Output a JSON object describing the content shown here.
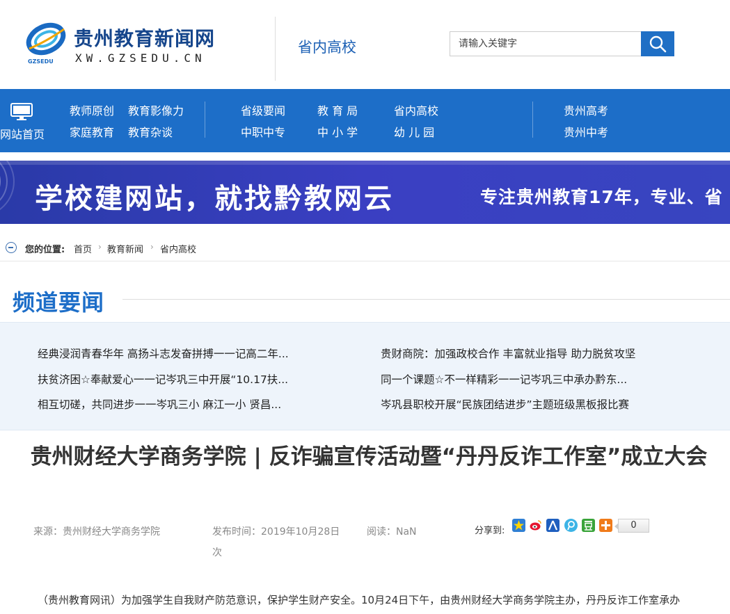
{
  "header": {
    "site_title": "贵州教育新闻网",
    "site_url": "XW.GZSEDU.CN",
    "logo_sub": "GZSEDU",
    "channel": "省内高校",
    "search_placeholder": "请输入关键字",
    "search_icon": "search-icon"
  },
  "nav": {
    "home_label": "网站首页",
    "group1": [
      "教师原创",
      "教育影像力",
      "家庭教育",
      "教育杂谈"
    ],
    "group2": [
      "省级要闻",
      "教 育 局",
      "省内高校",
      "中职中专",
      "中 小 学",
      "幼 儿 园"
    ],
    "group3": [
      "贵州高考",
      "贵州中考"
    ]
  },
  "banner": {
    "main": "学校建网站，就找黔教网云",
    "sub": "专注贵州教育17年，专业、省"
  },
  "breadcrumb": {
    "label": "您的位置:",
    "items": [
      "首页",
      "教育新闻",
      "省内高校"
    ]
  },
  "headlines": {
    "title": "频道要闻",
    "left": [
      "经典浸润青春华年 高扬斗志发奋拼搏一一记高二年...",
      "扶贫济困☆奉献爱心一一记岑巩三中开展“10.17扶...",
      "相互切磋，共同进步一一岑巩三小 麻江一小 贤昌..."
    ],
    "right": [
      "贵财商院：加强政校合作 丰富就业指导 助力脱贫攻坚",
      "同一个课题☆不一样精彩一一记岑巩三中承办黔东...",
      "岑巩县职校开展“民族团结进步”主题班级黑板报比赛"
    ]
  },
  "article": {
    "title": "贵州财经大学商务学院 | 反诈骗宣传活动暨“丹丹反诈工作室”成立大会",
    "source": "来源：贵州财经大学商务学院",
    "published": "发布时间：2019年10月28日",
    "reads_label": "阅读：NaN",
    "reads_unit": "次",
    "share_label": "分享到:",
    "share_count": "0",
    "body_first_line": "（贵州教育网讯）为加强学生自我财产防范意识，保护学生财产安全。10月24日下午，由贵州财经大学商务学院主办，丹丹反诈工作室承办"
  },
  "colors": {
    "brand_blue": "#1d6ec8",
    "title_blue": "#16468c",
    "banner_blue": "#3a3fc2",
    "headline_bg": "#eef4fb"
  }
}
